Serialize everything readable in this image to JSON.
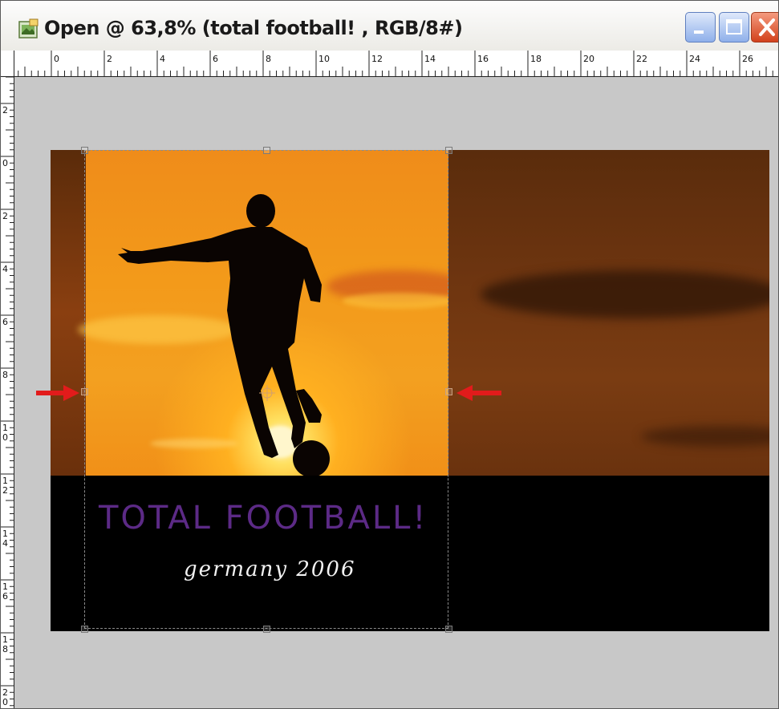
{
  "window": {
    "title": "Open @ 63,8% (total football! , RGB/8#)",
    "app_icon": "photoshop-document-icon",
    "controls": {
      "minimize": "minimize-icon",
      "maximize": "maximize-icon",
      "close": "close-icon"
    }
  },
  "rulers": {
    "horizontal_labels": [
      "0",
      "2",
      "4",
      "6",
      "8",
      "10",
      "12",
      "14",
      "16",
      "18",
      "20",
      "22",
      "24",
      "26"
    ],
    "vertical_labels": [
      "2",
      "0",
      "2",
      "4",
      "6",
      "8",
      "10",
      "12",
      "14",
      "16",
      "18",
      "20"
    ]
  },
  "image": {
    "headline": "TOTAL FOOTBALL!",
    "subline": "germany 2006",
    "headline_color": "#5c2a86",
    "subline_color": "#f2f2f2"
  },
  "colors": {
    "crop_guide": "#8a8a8a",
    "arrow": "#e21b1b",
    "canvas_background": "#c8c8c8"
  }
}
